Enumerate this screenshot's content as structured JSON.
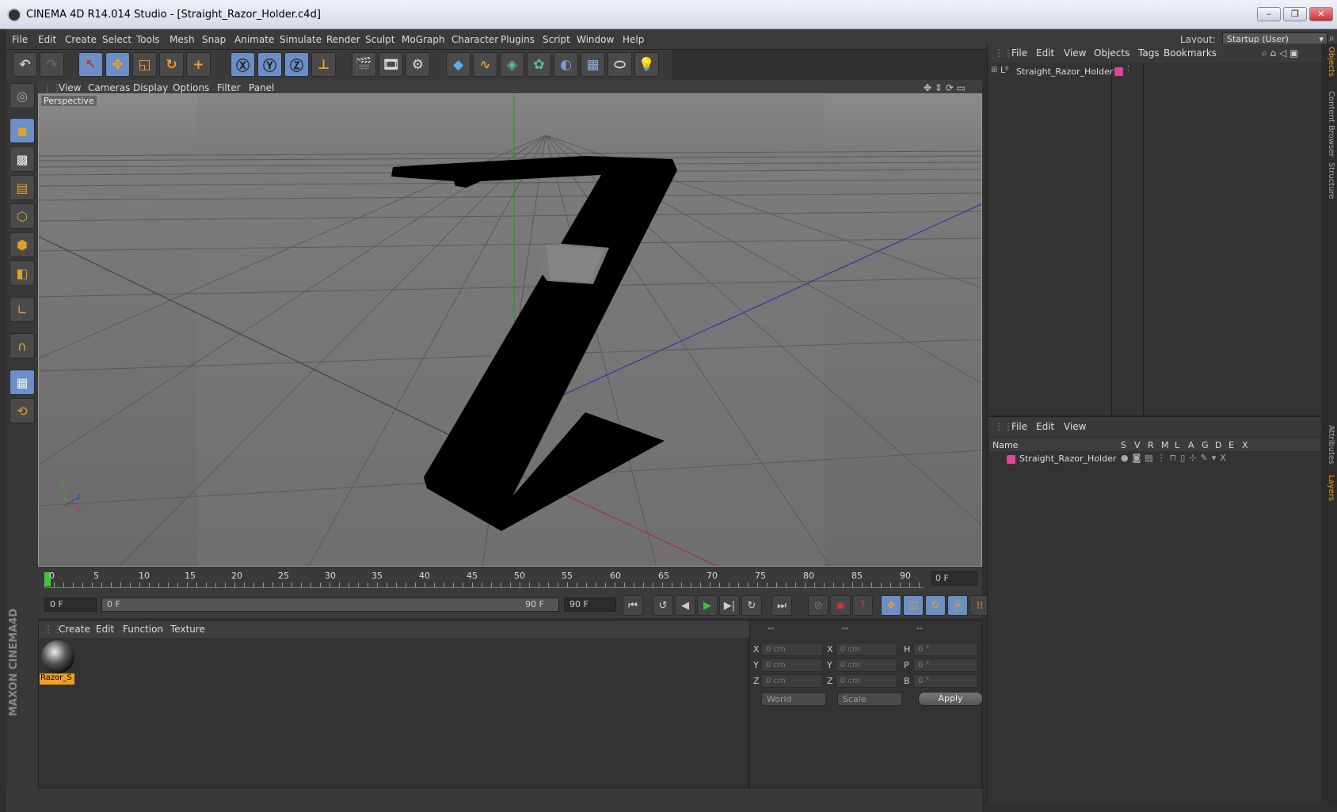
{
  "window": {
    "title": "CINEMA 4D R14.014 Studio - [Straight_Razor_Holder.c4d]",
    "min": "–",
    "max": "❐",
    "close": "✕"
  },
  "menu": [
    "File",
    "Edit",
    "Create",
    "Select",
    "Tools",
    "Mesh",
    "Snap",
    "Animate",
    "Simulate",
    "Render",
    "Sculpt",
    "MoGraph",
    "Character",
    "Plugins",
    "Script",
    "Window",
    "Help"
  ],
  "layout": {
    "label": "Layout:",
    "value": "Startup (User)"
  },
  "toolbar_icons": [
    "undo-icon",
    "redo-icon",
    "live-selection-icon",
    "move-icon",
    "scale-icon",
    "rotate-icon",
    "add-icon",
    "x-axis-icon",
    "y-axis-icon",
    "z-axis-icon",
    "coordinate-system-icon",
    "render-view-icon",
    "render-picture-viewer-icon",
    "edit-render-settings-icon",
    "cube-icon",
    "spline-icon",
    "nurbs-icon",
    "array-icon",
    "deformer-icon",
    "scene-floor-icon",
    "camera-icon",
    "light-icon"
  ],
  "viewport": {
    "menu": [
      "View",
      "Cameras",
      "Display",
      "Options",
      "Filter",
      "Panel"
    ],
    "label": "Perspective",
    "axis_y": "Y",
    "axis_z": "Z",
    "axis_x": "X"
  },
  "timeline": {
    "ticks": [
      "0",
      "5",
      "10",
      "15",
      "20",
      "25",
      "30",
      "35",
      "40",
      "45",
      "50",
      "55",
      "60",
      "65",
      "70",
      "75",
      "80",
      "85",
      "90"
    ],
    "current_frame": "0 F",
    "start_field": "0 F",
    "range_start": "0 F",
    "range_end": "90 F",
    "end_field": "90 F"
  },
  "material_panel": {
    "menu": [
      "Create",
      "Edit",
      "Function",
      "Texture"
    ],
    "material_name": "Razor_S"
  },
  "coordinates": {
    "headers": [
      "--",
      "--",
      "--"
    ],
    "rows": [
      {
        "a": "X",
        "av": "0 cm",
        "b": "X",
        "bv": "0 cm",
        "c": "H",
        "cv": "0 °"
      },
      {
        "a": "Y",
        "av": "0 cm",
        "b": "Y",
        "bv": "0 cm",
        "c": "P",
        "cv": "0 °"
      },
      {
        "a": "Z",
        "av": "0 cm",
        "b": "Z",
        "bv": "0 cm",
        "c": "B",
        "cv": "0 °"
      }
    ],
    "mode1": "World",
    "mode2": "Scale",
    "apply": "Apply"
  },
  "object_manager": {
    "menu": [
      "File",
      "Edit",
      "View",
      "Objects",
      "Tags",
      "Bookmarks"
    ],
    "object": "Straight_Razor_Holder",
    "color": "#e0449c"
  },
  "layer_manager": {
    "menu": [
      "File",
      "Edit",
      "View"
    ],
    "header_name": "Name",
    "columns": [
      "S",
      "V",
      "R",
      "M",
      "L",
      "A",
      "G",
      "D",
      "E",
      "X"
    ],
    "layer": "Straight_Razor_Holder"
  },
  "side_tabs": [
    "Objects",
    "Content Browser",
    "Structure",
    "Attributes",
    "Layers"
  ],
  "brand": "MAXON CINEMA4D"
}
